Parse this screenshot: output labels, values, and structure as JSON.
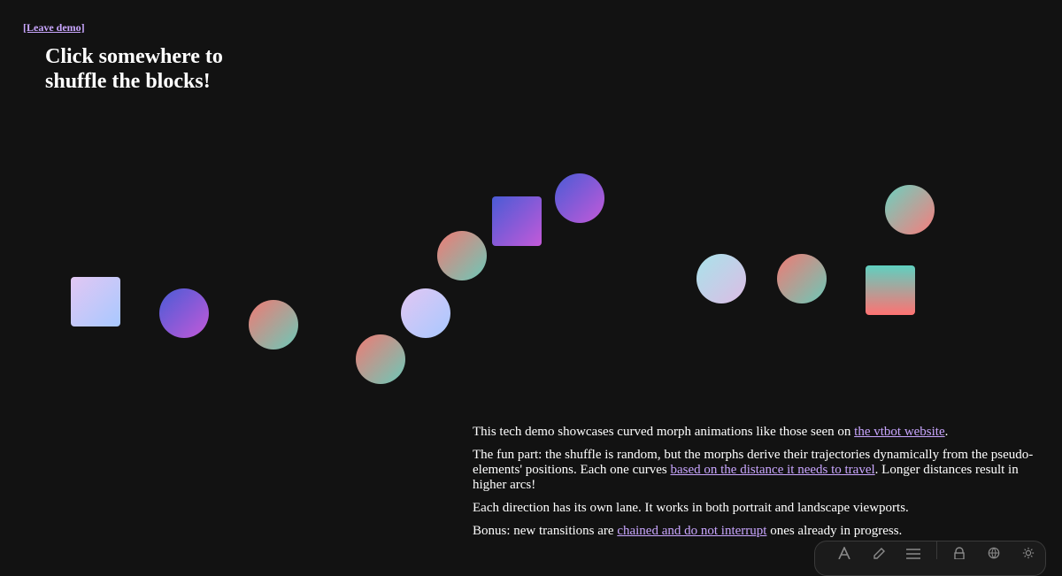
{
  "nav": {
    "leave_label": "[Leave demo]"
  },
  "heading": {
    "title": "Click somewhere to shuffle the blocks!"
  },
  "info": {
    "p1": {
      "text": "This tech demo showcases curved morph animations like those seen on ",
      "link": "the vtbot website",
      "after": "."
    },
    "p2": {
      "text": "The fun part: the shuffle is random, but the morphs derive their trajectories dynamically from the pseudo-elements' positions. Each one curves ",
      "link": "based on the distance it needs to travel",
      "after": ". Longer distances result in higher arcs!"
    },
    "p3": {
      "text": "Each direction has its own lane. It works in both portrait and landscape viewports."
    },
    "p4": {
      "text": "Bonus: new transitions are ",
      "link": "chained and do not interrupt",
      "after": " ones already in progress."
    }
  },
  "toolbar": {
    "icons": [
      "a-icon",
      "pencil-icon",
      "menu-icon",
      "lock-icon",
      "globe-icon",
      "gear-icon"
    ]
  }
}
